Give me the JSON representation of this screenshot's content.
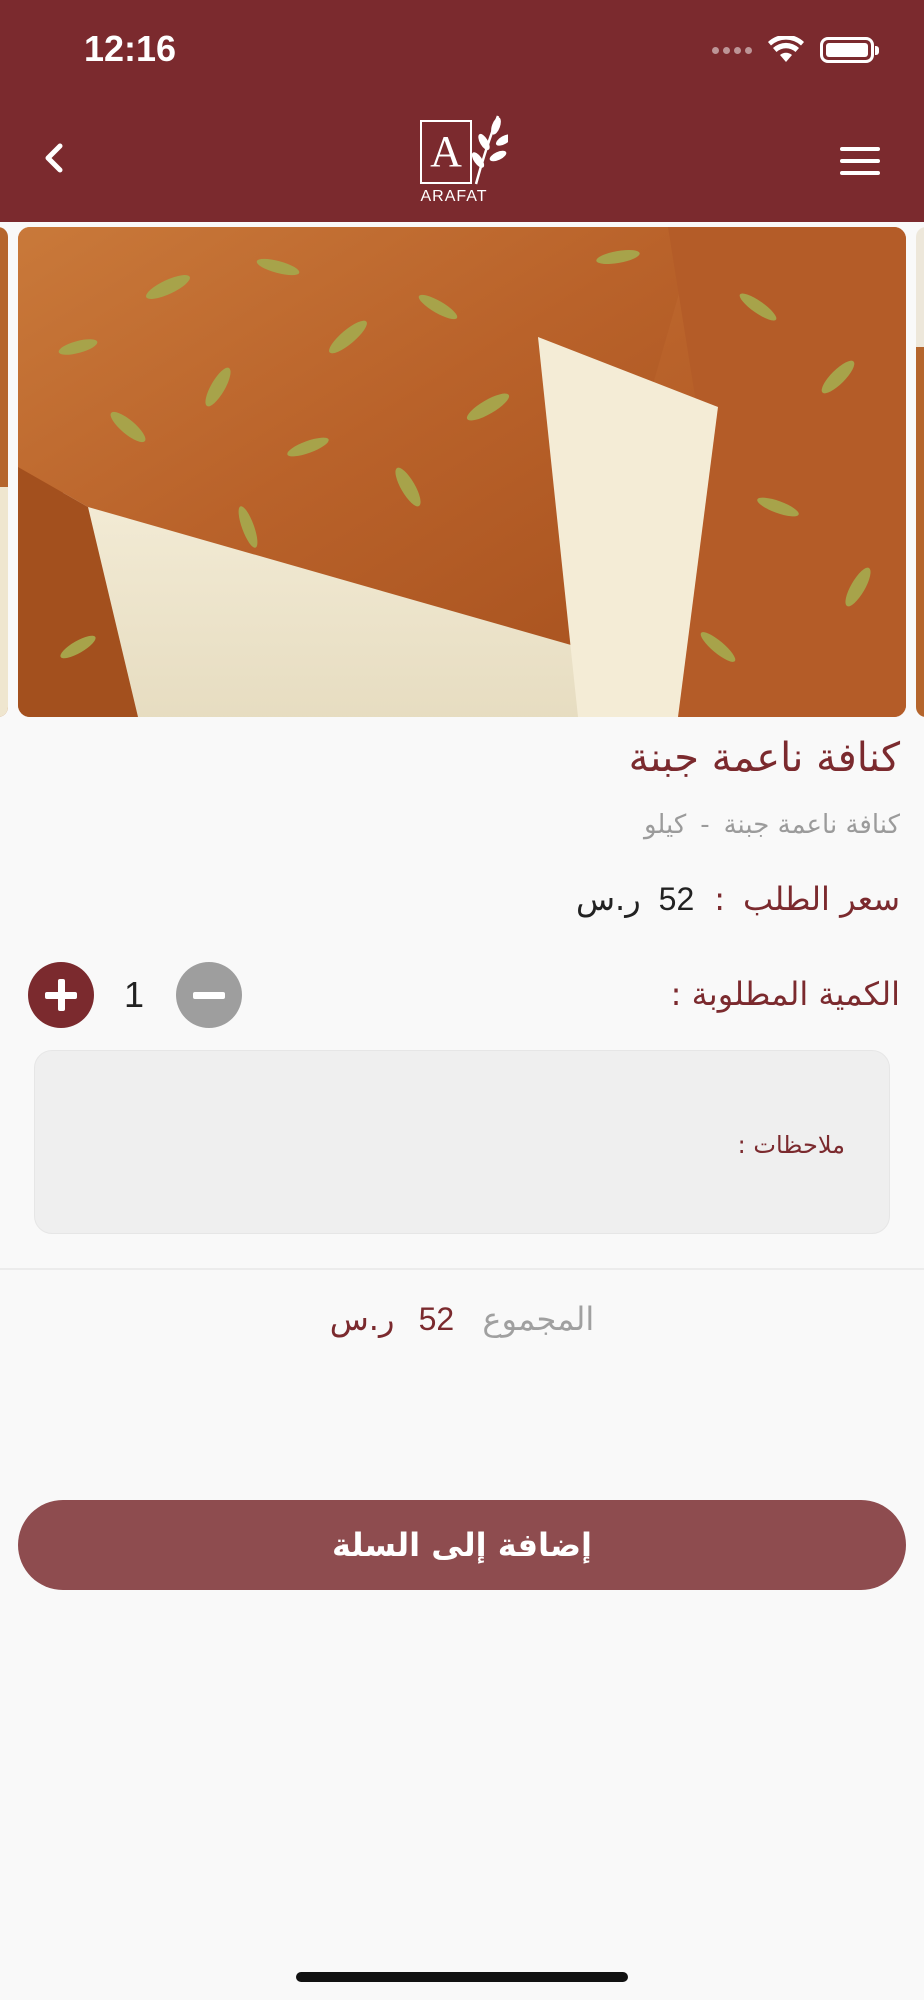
{
  "status_bar": {
    "time": "12:16"
  },
  "header": {
    "logo_letter": "A",
    "logo_text": "ARAFAT"
  },
  "product": {
    "title": "كنافة ناعمة جبنة",
    "subtitle_name": "كنافة ناعمة جبنة",
    "subtitle_sep": "-",
    "subtitle_unit": "كيلو",
    "price_label": "سعر الطلب",
    "price_colon": ":",
    "price_value": "52",
    "currency": "ر.س",
    "quantity_label": "الكمية المطلوبة :",
    "quantity_value": "1",
    "notes_label": "ملاحظات :"
  },
  "total": {
    "label": "المجموع",
    "value": "52",
    "currency": "ر.س"
  },
  "actions": {
    "add_to_cart": "إضافة إلى السلة"
  },
  "colors": {
    "brand": "#7b2a2e",
    "button": "#8e4c4f",
    "muted": "#9e9e9e"
  },
  "image": {
    "subject": "kunafa-cheese-photo"
  }
}
